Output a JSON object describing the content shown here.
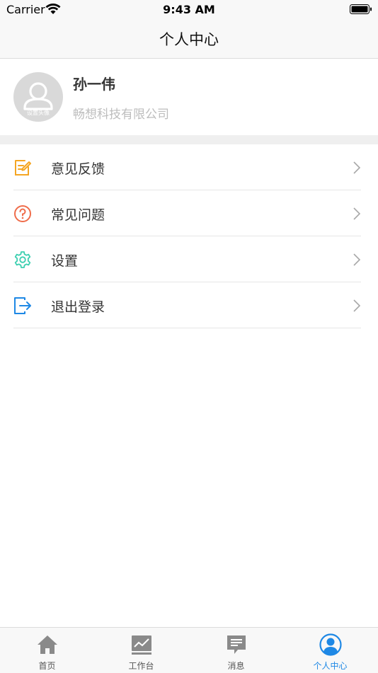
{
  "status_bar": {
    "carrier": "Carrier",
    "time": "9:43 AM"
  },
  "nav": {
    "title": "个人中心"
  },
  "profile": {
    "avatar_caption": "设置头像",
    "name": "孙一伟",
    "company": "畅想科技有限公司"
  },
  "menu": [
    {
      "label": "意见反馈",
      "icon": "feedback-icon",
      "color": "#f5a623"
    },
    {
      "label": "常见问题",
      "icon": "question-icon",
      "color": "#ef6c4a"
    },
    {
      "label": "设置",
      "icon": "gear-icon",
      "color": "#3ccfb0"
    },
    {
      "label": "退出登录",
      "icon": "logout-icon",
      "color": "#1e88e5"
    }
  ],
  "tabs": [
    {
      "label": "首页",
      "icon": "home-icon"
    },
    {
      "label": "工作台",
      "icon": "chart-icon"
    },
    {
      "label": "消息",
      "icon": "message-icon"
    },
    {
      "label": "个人中心",
      "icon": "profile-icon",
      "active": true
    }
  ],
  "colors": {
    "accent": "#1e88e5",
    "tab_icon": "#8a8a8a"
  }
}
